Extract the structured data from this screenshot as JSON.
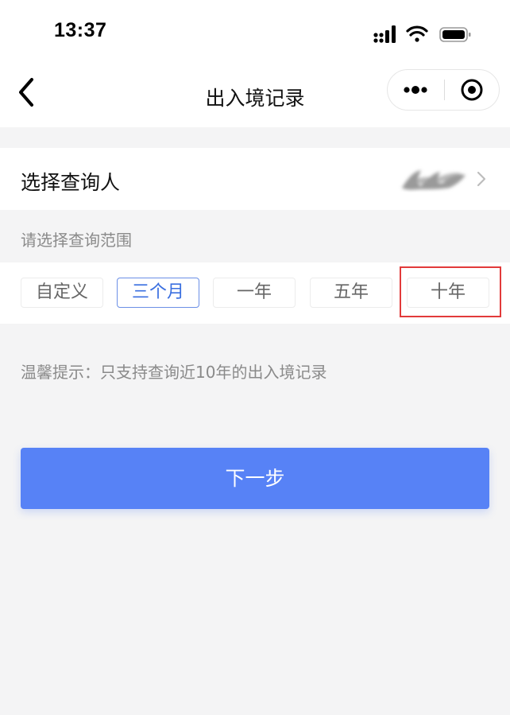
{
  "status_bar": {
    "time": "13:37",
    "icons": [
      "cellular-signal-icon",
      "wifi-icon",
      "battery-icon"
    ]
  },
  "nav": {
    "title": "出入境记录",
    "back_icon": "chevron-left-icon",
    "more_icon": "more-dots-icon",
    "close_icon": "target-circle-icon"
  },
  "person": {
    "label": "选择查询人",
    "arrow_icon": "chevron-right-icon"
  },
  "range": {
    "label": "请选择查询范围",
    "options": [
      "自定义",
      "三个月",
      "一年",
      "五年",
      "十年"
    ],
    "selected": "三个月"
  },
  "tip": "温馨提示：只支持查询近10年的出入境记录",
  "next_button": "下一步",
  "colors": {
    "primary": "#5782f6",
    "selected_text": "#3a6fe0",
    "highlight": "#e23a3a",
    "background": "#f4f4f5"
  }
}
